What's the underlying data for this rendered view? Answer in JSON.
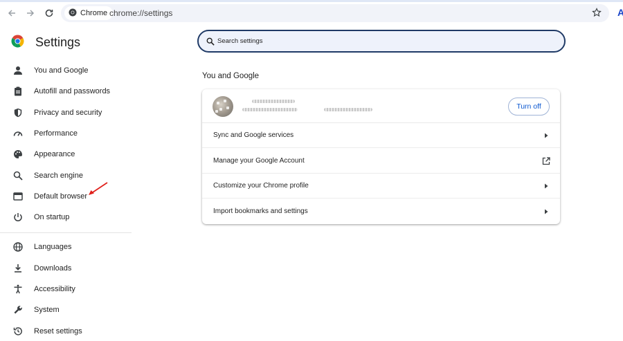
{
  "browser": {
    "chip_label": "Chrome",
    "url": "chrome://settings",
    "profile_letter": "A",
    "icons": [
      "back-icon",
      "forward-icon",
      "reload-icon",
      "chrome-logo-icon",
      "star-icon"
    ]
  },
  "sidebar": {
    "title": "Settings",
    "items": [
      {
        "label": "You and Google",
        "icon": "person-icon"
      },
      {
        "label": "Autofill and passwords",
        "icon": "clipboard-icon"
      },
      {
        "label": "Privacy and security",
        "icon": "shield-icon"
      },
      {
        "label": "Performance",
        "icon": "speedometer-icon"
      },
      {
        "label": "Appearance",
        "icon": "palette-icon"
      },
      {
        "label": "Search engine",
        "icon": "search-icon"
      },
      {
        "label": "Default browser",
        "icon": "browser-window-icon"
      },
      {
        "label": "On startup",
        "icon": "power-icon"
      },
      {
        "label": "Languages",
        "icon": "globe-icon"
      },
      {
        "label": "Downloads",
        "icon": "download-icon"
      },
      {
        "label": "Accessibility",
        "icon": "accessibility-icon"
      },
      {
        "label": "System",
        "icon": "wrench-icon"
      },
      {
        "label": "Reset settings",
        "icon": "history-icon"
      }
    ]
  },
  "search": {
    "placeholder": "Search settings"
  },
  "main": {
    "section_title": "You and Google",
    "account": {
      "turn_off_label": "Turn off"
    },
    "rows": [
      {
        "label": "Sync and Google services",
        "icon": "arrow-right-icon"
      },
      {
        "label": "Manage your Google Account",
        "icon": "open-external-icon"
      },
      {
        "label": "Customize your Chrome profile",
        "icon": "arrow-right-icon"
      },
      {
        "label": "Import bookmarks and settings",
        "icon": "arrow-right-icon"
      }
    ]
  },
  "colors": {
    "accent": "#0b57d0",
    "search_border": "#1f3a66",
    "annotation_arrow": "#e0201b"
  }
}
